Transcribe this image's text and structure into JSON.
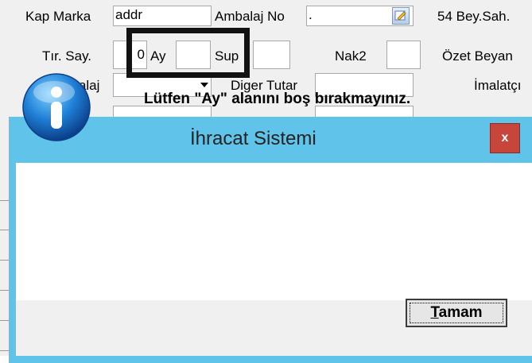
{
  "form": {
    "kap_marka_label": "Kap Marka",
    "kap_marka_value": "addr",
    "ambalaj_no_label": "Ambalaj No",
    "ambalaj_no_value": ".",
    "bey_sah_label": "54 Bey.Sah.",
    "tir_say_label": "Tır. Say.",
    "tir_say_value": "0",
    "ay_label": "Ay",
    "ay_value": "",
    "sup_label": "Sup",
    "sup_value": "",
    "nak2_label": "Nak2",
    "nak2_value": "",
    "ozet_beyan_label": "Özet Beyan",
    "ambalaj_label": "Ambalaj",
    "ambalaj_value": "",
    "diger_tutar_label": "Diger Tutar",
    "diger_tutar_value": "",
    "imalatci_label": "İmalatçı"
  },
  "dialog": {
    "title": "İhracat Sistemi",
    "close_label": "x",
    "message": "Lütfen \"Ay\" alanını boş bırakmayınız.",
    "icon": "info-icon",
    "ok_button_letter": "T",
    "ok_button_rest": "amam"
  },
  "colors": {
    "dialog_frame": "#5fc3ea",
    "close_button": "#c8453b",
    "highlight_box": "#111111"
  }
}
